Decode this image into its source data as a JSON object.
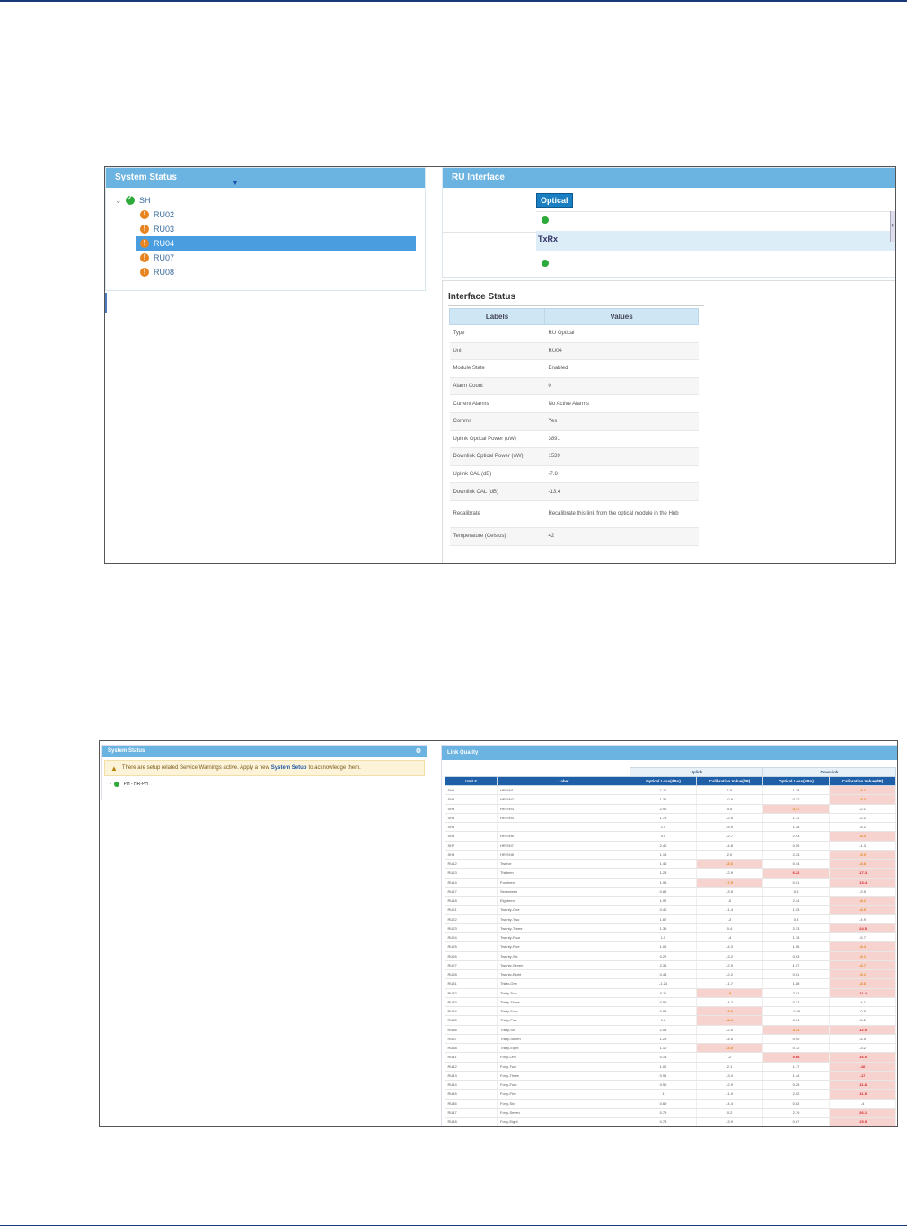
{
  "shot1": {
    "system_status": {
      "title": "System Status",
      "root": "SH",
      "children": [
        "RU02",
        "RU03",
        "RU04",
        "RU07",
        "RU08"
      ],
      "selected": "RU04"
    },
    "ru_interface": {
      "title": "RU Interface",
      "optical_label": "Optical",
      "txrx_label": "TxRx"
    },
    "interface_status": {
      "title": "Interface Status",
      "col_labels": "Labels",
      "col_values": "Values",
      "rows": [
        {
          "label": "Type",
          "value": "RU Optical"
        },
        {
          "label": "Unit",
          "value": "RU04"
        },
        {
          "label": "Module State",
          "value": "Enabled"
        },
        {
          "label": "Alarm Count",
          "value": "0"
        },
        {
          "label": "Current Alarms",
          "value": "No Active Alarms"
        },
        {
          "label": "Comms",
          "value": "Yes"
        },
        {
          "label": "Uplink Optical Power (uW)",
          "value": "3891"
        },
        {
          "label": "Downlink Optical Power (uW)",
          "value": "1539"
        },
        {
          "label": "Uplink CAL (dB)",
          "value": "-7.8"
        },
        {
          "label": "Downlink CAL (dB)",
          "value": "-13.4"
        },
        {
          "label": "Recalibrate",
          "value": "Recalibrate this link from the optical module in the Hub"
        },
        {
          "label": "Temperature (Celsius)",
          "value": "42"
        }
      ]
    }
  },
  "shot2": {
    "system_status": {
      "title": "System Status",
      "warning_pre": "There are setup related Service Warnings active. Apply a new",
      "warning_link": "System Setup",
      "warning_post": "to acknowledge them.",
      "root": "PH - HR-PH"
    },
    "link_quality": {
      "title": "Link Quality",
      "group_uplink": "Uplink",
      "group_downlink": "Downlink",
      "columns": [
        "Unit #",
        "Label",
        "Optical Loss(dBo)",
        "Calibration Value(dB)",
        "Optical Loss(dBo)",
        "Calibration Value(dB)"
      ],
      "rows": [
        {
          "unit": "SH1",
          "label": "HR-SH1",
          "ul_loss": "1.11",
          "ul_cal": "1.5",
          "dl_loss": "1.28",
          "dl_cal": "-8.1",
          "flags": [
            "",
            "",
            "",
            "w"
          ]
        },
        {
          "unit": "SH2",
          "label": "HR-SH2",
          "ul_loss": "1.32",
          "ul_cal": "-0.9",
          "dl_loss": "0.32",
          "dl_cal": "-9.3",
          "flags": [
            "",
            "",
            "",
            "w"
          ]
        },
        {
          "unit": "SH3",
          "label": "HR-SH3",
          "ul_loss": "2.90",
          "ul_cal": "0.5",
          "dl_loss": "4.37",
          "dl_cal": "-2.1",
          "flags": [
            "",
            "",
            "w",
            ""
          ]
        },
        {
          "unit": "SH4",
          "label": "HR-SH4",
          "ul_loss": "1.79",
          "ul_cal": "-2.5",
          "dl_loss": "1.12",
          "dl_cal": "-2.2",
          "flags": [
            "",
            "",
            "",
            ""
          ]
        },
        {
          "unit": "SH5",
          "label": "",
          "ul_loss": "1.5",
          "ul_cal": "-5.9",
          "dl_loss": "1.38",
          "dl_cal": "-4.2",
          "flags": [
            "",
            "",
            "",
            ""
          ]
        },
        {
          "unit": "SH6",
          "label": "HR-SH6",
          "ul_loss": "0.5",
          "ul_cal": "-2.7",
          "dl_loss": "2.93",
          "dl_cal": "-8.4",
          "flags": [
            "",
            "",
            "",
            "w"
          ]
        },
        {
          "unit": "SH7",
          "label": "HR-SH7",
          "ul_loss": "2.40",
          "ul_cal": "-4.8",
          "dl_loss": "0.59",
          "dl_cal": "-1.3",
          "flags": [
            "",
            "",
            "",
            ""
          ]
        },
        {
          "unit": "SH8",
          "label": "HR-SH8",
          "ul_loss": "1.13",
          "ul_cal": "2.0",
          "dl_loss": "2.23",
          "dl_cal": "-9.9",
          "flags": [
            "",
            "",
            "",
            "w"
          ]
        },
        {
          "unit": "RU12",
          "label": "Twelve",
          "ul_loss": "1.45",
          "ul_cal": "-8.6",
          "dl_loss": "0.44",
          "dl_cal": "-8.8",
          "flags": [
            "",
            "w",
            "",
            "w"
          ]
        },
        {
          "unit": "RU13",
          "label": "Thirteen",
          "ul_loss": "1.28",
          "ul_cal": "-2.9",
          "dl_loss": "6.22",
          "dl_cal": "-17.3",
          "flags": [
            "",
            "",
            "e",
            "e"
          ]
        },
        {
          "unit": "RU14",
          "label": "Fourteen",
          "ul_loss": "1.95",
          "ul_cal": "-7.5",
          "dl_loss": "0.51",
          "dl_cal": "-13.4",
          "flags": [
            "",
            "w",
            "",
            "e"
          ]
        },
        {
          "unit": "RU17",
          "label": "Seventeen",
          "ul_loss": "0.89",
          "ul_cal": "-3.5",
          "dl_loss": "0.5",
          "dl_cal": "-3.5",
          "flags": [
            "",
            "",
            "",
            ""
          ]
        },
        {
          "unit": "RU18",
          "label": "Eighteen",
          "ul_loss": "1.97",
          "ul_cal": "-5",
          "dl_loss": "2.44",
          "dl_cal": "-8.2",
          "flags": [
            "",
            "",
            "",
            "w"
          ]
        },
        {
          "unit": "RU21",
          "label": "Twenty-One",
          "ul_loss": "0.40",
          "ul_cal": "-1.4",
          "dl_loss": "1.03",
          "dl_cal": "-8.5",
          "flags": [
            "",
            "",
            "",
            "w"
          ]
        },
        {
          "unit": "RU22",
          "label": "Twenty-Two",
          "ul_loss": "1.67",
          "ul_cal": "-3",
          "dl_loss": "0.8",
          "dl_cal": "-4.9",
          "flags": [
            "",
            "",
            "",
            ""
          ]
        },
        {
          "unit": "RU23",
          "label": "Twenty-Three",
          "ul_loss": "1.39",
          "ul_cal": "0.4",
          "dl_loss": "2.33",
          "dl_cal": "-24.5",
          "flags": [
            "",
            "",
            "",
            "e"
          ]
        },
        {
          "unit": "RU24",
          "label": "Twenty-Four",
          "ul_loss": "1.5",
          "ul_cal": "-4",
          "dl_loss": "1.18",
          "dl_cal": "-5.7",
          "flags": [
            "",
            "",
            "",
            ""
          ]
        },
        {
          "unit": "RU25",
          "label": "Twenty-Five",
          "ul_loss": "1.09",
          "ul_cal": "-4.3",
          "dl_loss": "1.06",
          "dl_cal": "-8.4",
          "flags": [
            "",
            "",
            "",
            "w"
          ]
        },
        {
          "unit": "RU26",
          "label": "Twenty-Six",
          "ul_loss": "0.22",
          "ul_cal": "-3.2",
          "dl_loss": "0.63",
          "dl_cal": "-9.1",
          "flags": [
            "",
            "",
            "",
            "w"
          ]
        },
        {
          "unit": "RU27",
          "label": "Twenty-Seven",
          "ul_loss": "2.36",
          "ul_cal": "-2.9",
          "dl_loss": "1.57",
          "dl_cal": "-8.7",
          "flags": [
            "",
            "",
            "",
            "w"
          ]
        },
        {
          "unit": "RU28",
          "label": "Twenty-Eight",
          "ul_loss": "0.48",
          "ul_cal": "-2.2",
          "dl_loss": "0.61",
          "dl_cal": "-9.1",
          "flags": [
            "",
            "",
            "",
            "w"
          ]
        },
        {
          "unit": "RU31",
          "label": "Thirty-One",
          "ul_loss": "-1.24",
          "ul_cal": "-1.7",
          "dl_loss": "1.88",
          "dl_cal": "-8.6",
          "flags": [
            "",
            "",
            "",
            "w"
          ]
        },
        {
          "unit": "RU32",
          "label": "Thirty-Two",
          "ul_loss": "0.11",
          "ul_cal": "-9",
          "dl_loss": "2.01",
          "dl_cal": "-11.4",
          "flags": [
            "",
            "w",
            "",
            "e"
          ]
        },
        {
          "unit": "RU33",
          "label": "Thirty-Three",
          "ul_loss": "0.59",
          "ul_cal": "-4.2",
          "dl_loss": "0.37",
          "dl_cal": "-4.1",
          "flags": [
            "",
            "",
            "",
            ""
          ]
        },
        {
          "unit": "RU34",
          "label": "Thirty-Four",
          "ul_loss": "0.93",
          "ul_cal": "-8.6",
          "dl_loss": "-0.09",
          "dl_cal": "-0.5",
          "flags": [
            "",
            "w",
            "",
            ""
          ]
        },
        {
          "unit": "RU35",
          "label": "Thirty-Five",
          "ul_loss": "1.6",
          "ul_cal": "-8.4",
          "dl_loss": "0.54",
          "dl_cal": "-5.2",
          "flags": [
            "",
            "w",
            "",
            ""
          ]
        },
        {
          "unit": "RU36",
          "label": "Thirty-Six",
          "ul_loss": "2.08",
          "ul_cal": "-2.5",
          "dl_loss": "4.31",
          "dl_cal": "-12.9",
          "flags": [
            "",
            "",
            "w",
            "e"
          ]
        },
        {
          "unit": "RU37",
          "label": "Thirty-Seven",
          "ul_loss": "1.29",
          "ul_cal": "-4.5",
          "dl_loss": "0.90",
          "dl_cal": "-4.5",
          "flags": [
            "",
            "",
            "",
            ""
          ]
        },
        {
          "unit": "RU38",
          "label": "Thirty-Eight",
          "ul_loss": "1.10",
          "ul_cal": "-8.5",
          "dl_loss": "0.72",
          "dl_cal": "-3.2",
          "flags": [
            "",
            "w",
            "",
            ""
          ]
        },
        {
          "unit": "RU41",
          "label": "Forty-One",
          "ul_loss": "0.18",
          "ul_cal": "-2",
          "dl_loss": "5.68",
          "dl_cal": "-16.0",
          "flags": [
            "",
            "",
            "e",
            "e"
          ]
        },
        {
          "unit": "RU42",
          "label": "Forty-Two",
          "ul_loss": "1.02",
          "ul_cal": "2.1",
          "dl_loss": "1.17",
          "dl_cal": "-16",
          "flags": [
            "",
            "",
            "",
            "e"
          ]
        },
        {
          "unit": "RU43",
          "label": "Forty-Three",
          "ul_loss": "0.91",
          "ul_cal": "-3.4",
          "dl_loss": "1.44",
          "dl_cal": "-17",
          "flags": [
            "",
            "",
            "",
            "e"
          ]
        },
        {
          "unit": "RU44",
          "label": "Forty-Four",
          "ul_loss": "0.50",
          "ul_cal": "-2.9",
          "dl_loss": "0.25",
          "dl_cal": "-11.8",
          "flags": [
            "",
            "",
            "",
            "e"
          ]
        },
        {
          "unit": "RU45",
          "label": "Forty-Five",
          "ul_loss": "1",
          "ul_cal": "-1.9",
          "dl_loss": "2.02",
          "dl_cal": "-11.5",
          "flags": [
            "",
            "",
            "",
            "e"
          ]
        },
        {
          "unit": "RU46",
          "label": "Forty-Six",
          "ul_loss": "0.69",
          "ul_cal": "-4.4",
          "dl_loss": "0.62",
          "dl_cal": "-4",
          "flags": [
            "",
            "",
            "",
            ""
          ]
        },
        {
          "unit": "RU47",
          "label": "Forty-Seven",
          "ul_loss": "0.79",
          "ul_cal": "0.2",
          "dl_loss": "2.19",
          "dl_cal": "-26.1",
          "flags": [
            "",
            "",
            "",
            "e"
          ]
        },
        {
          "unit": "RU48",
          "label": "Forty-Eight",
          "ul_loss": "0.73",
          "ul_cal": "-3.9",
          "dl_loss": "0.67",
          "dl_cal": "-15.5",
          "flags": [
            "",
            "",
            "",
            "e"
          ]
        }
      ]
    }
  }
}
